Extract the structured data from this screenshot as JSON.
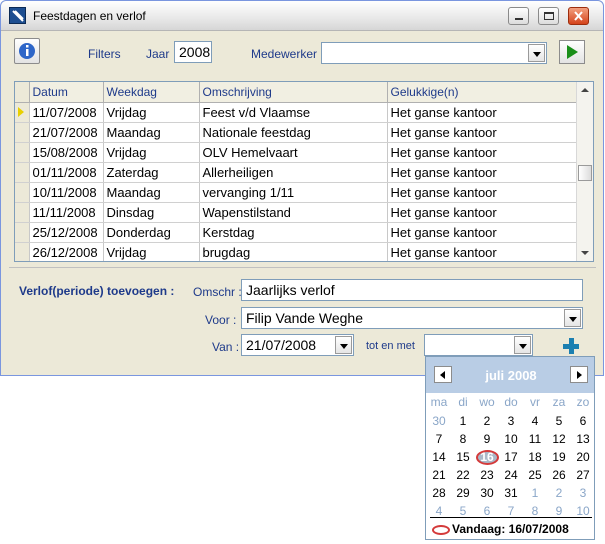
{
  "window": {
    "title": "Feestdagen en verlof"
  },
  "filters": {
    "label": "Filters",
    "jaar_label": "Jaar",
    "jaar_value": "2008",
    "medewerker_label": "Medewerker",
    "medewerker_value": ""
  },
  "grid": {
    "columns": [
      "Datum",
      "Weekdag",
      "Omschrijving",
      "Gelukkige(n)"
    ],
    "rows": [
      [
        "11/07/2008",
        "Vrijdag",
        "Feest v/d Vlaamse",
        "Het ganse kantoor"
      ],
      [
        "21/07/2008",
        "Maandag",
        "Nationale feestdag",
        "Het ganse kantoor"
      ],
      [
        "15/08/2008",
        "Vrijdag",
        "OLV Hemelvaart",
        "Het ganse kantoor"
      ],
      [
        "01/11/2008",
        "Zaterdag",
        "Allerheiligen",
        "Het ganse kantoor"
      ],
      [
        "10/11/2008",
        "Maandag",
        "vervanging 1/11",
        "Het ganse kantoor"
      ],
      [
        "11/11/2008",
        "Dinsdag",
        "Wapenstilstand",
        "Het ganse kantoor"
      ],
      [
        "25/12/2008",
        "Donderdag",
        "Kerstdag",
        "Het ganse kantoor"
      ],
      [
        "26/12/2008",
        "Vrijdag",
        "brugdag",
        "Het ganse kantoor"
      ]
    ]
  },
  "verlof": {
    "section_label": "Verlof(periode) toevoegen :",
    "omschr_label": "Omschr :",
    "omschr_value": "Jaarlijks verlof",
    "voor_label": "Voor :",
    "voor_value": "Filip Vande Weghe",
    "van_label": "Van :",
    "van_value": "21/07/2008",
    "tot_label": "tot en met",
    "tot_value": ""
  },
  "calendar": {
    "month_label": "juli 2008",
    "weekdays": [
      "ma",
      "di",
      "wo",
      "do",
      "vr",
      "za",
      "zo"
    ],
    "weeks": [
      [
        {
          "d": "30",
          "o": true
        },
        {
          "d": "1"
        },
        {
          "d": "2"
        },
        {
          "d": "3"
        },
        {
          "d": "4"
        },
        {
          "d": "5"
        },
        {
          "d": "6"
        }
      ],
      [
        {
          "d": "7"
        },
        {
          "d": "8"
        },
        {
          "d": "9"
        },
        {
          "d": "10"
        },
        {
          "d": "11"
        },
        {
          "d": "12"
        },
        {
          "d": "13"
        }
      ],
      [
        {
          "d": "14"
        },
        {
          "d": "15"
        },
        {
          "d": "16",
          "t": true
        },
        {
          "d": "17"
        },
        {
          "d": "18"
        },
        {
          "d": "19"
        },
        {
          "d": "20"
        }
      ],
      [
        {
          "d": "21"
        },
        {
          "d": "22"
        },
        {
          "d": "23"
        },
        {
          "d": "24"
        },
        {
          "d": "25"
        },
        {
          "d": "26"
        },
        {
          "d": "27"
        }
      ],
      [
        {
          "d": "28"
        },
        {
          "d": "29"
        },
        {
          "d": "30"
        },
        {
          "d": "31"
        },
        {
          "d": "1",
          "o": true
        },
        {
          "d": "2",
          "o": true
        },
        {
          "d": "3",
          "o": true
        }
      ],
      [
        {
          "d": "4",
          "o": true
        },
        {
          "d": "5",
          "o": true
        },
        {
          "d": "6",
          "o": true
        },
        {
          "d": "7",
          "o": true
        },
        {
          "d": "8",
          "o": true
        },
        {
          "d": "9",
          "o": true
        },
        {
          "d": "10",
          "o": true
        }
      ]
    ],
    "today_label": "Vandaag: 16/07/2008"
  },
  "icons": [
    "app-icon",
    "info-icon",
    "minimize-icon",
    "maximize-icon",
    "close-icon",
    "play-icon",
    "add-icon",
    "chevron-down-icon",
    "chevron-left-icon",
    "chevron-right-icon",
    "today-circle-icon"
  ]
}
